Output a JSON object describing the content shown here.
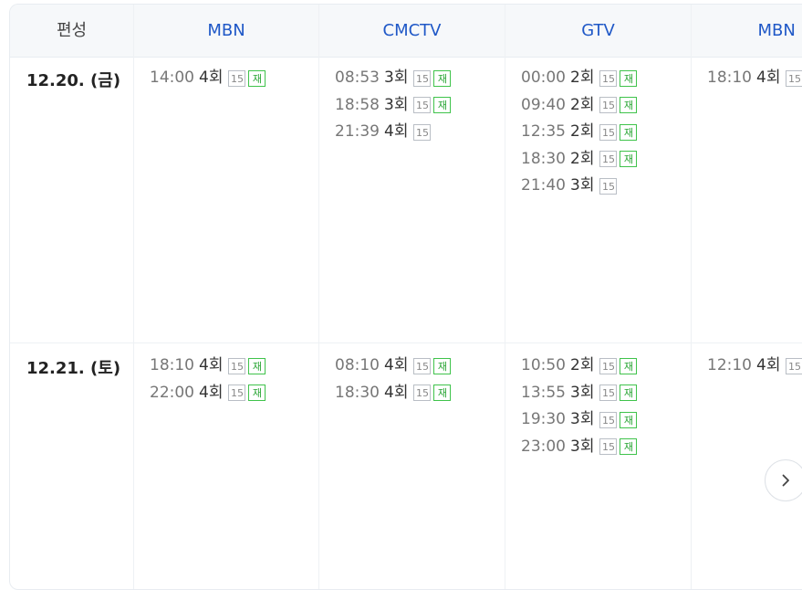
{
  "header": {
    "first_label": "편성",
    "channels": [
      "MBN",
      "CMCTV",
      "GTV",
      "MBN P"
    ]
  },
  "badges": {
    "age": "15",
    "rerun": "재"
  },
  "rows": [
    {
      "date": "12.20. (금)",
      "cells": [
        [
          {
            "time": "14:00",
            "episode": "4회",
            "rerun": true
          }
        ],
        [
          {
            "time": "08:53",
            "episode": "3회",
            "rerun": true
          },
          {
            "time": "18:58",
            "episode": "3회",
            "rerun": true
          },
          {
            "time": "21:39",
            "episode": "4회",
            "rerun": false
          }
        ],
        [
          {
            "time": "00:00",
            "episode": "2회",
            "rerun": true
          },
          {
            "time": "09:40",
            "episode": "2회",
            "rerun": true
          },
          {
            "time": "12:35",
            "episode": "2회",
            "rerun": true
          },
          {
            "time": "18:30",
            "episode": "2회",
            "rerun": true
          },
          {
            "time": "21:40",
            "episode": "3회",
            "rerun": false
          }
        ],
        [
          {
            "time": "18:10",
            "episode": "4회",
            "rerun": false
          }
        ]
      ]
    },
    {
      "date": "12.21. (토)",
      "cells": [
        [
          {
            "time": "18:10",
            "episode": "4회",
            "rerun": true
          },
          {
            "time": "22:00",
            "episode": "4회",
            "rerun": true
          }
        ],
        [
          {
            "time": "08:10",
            "episode": "4회",
            "rerun": true
          },
          {
            "time": "18:30",
            "episode": "4회",
            "rerun": true
          }
        ],
        [
          {
            "time": "10:50",
            "episode": "2회",
            "rerun": true
          },
          {
            "time": "13:55",
            "episode": "3회",
            "rerun": true
          },
          {
            "time": "19:30",
            "episode": "3회",
            "rerun": true
          },
          {
            "time": "23:00",
            "episode": "3회",
            "rerun": true
          }
        ],
        [
          {
            "time": "12:10",
            "episode": "4회",
            "rerun": false
          }
        ]
      ]
    }
  ],
  "icons": {
    "next": "chevron-right-icon"
  }
}
